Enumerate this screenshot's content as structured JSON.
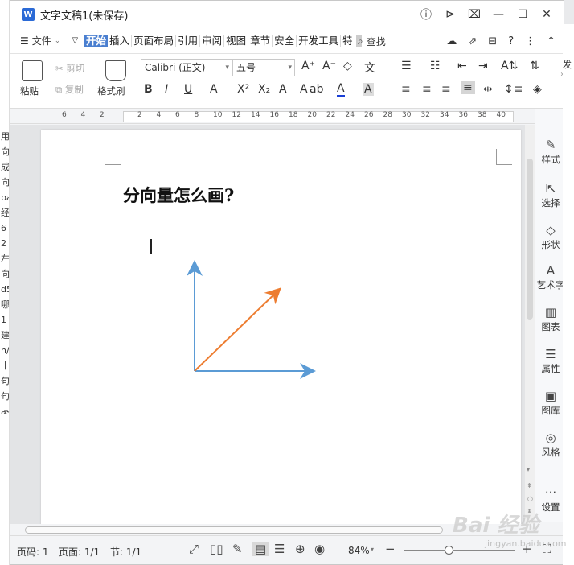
{
  "bg_left": [
    "用",
    "向",
    "成",
    "向",
    "ba",
    "经",
    "6",
    "2",
    "左",
    "向",
    "d5",
    "哪",
    "1",
    "建",
    "n/",
    "十",
    "句",
    "句",
    "as"
  ],
  "bg_right": [
    "",
    "发",
    "",
    "",
    "",
    "",
    "",
    "",
    "",
    "",
    "",
    "",
    "",
    "",
    "",
    "",
    "",
    "",
    "",
    "",
    "",
    "",
    "",
    "",
    "",
    "",
    "",
    "",
    ""
  ],
  "window": {
    "title": "文字文稿1(未保存)",
    "logo": "W"
  },
  "title_controls": [
    "ⓘ",
    "⊳",
    "⌧",
    "—",
    "☐",
    "✕"
  ],
  "menubar": {
    "file": "文件",
    "tabs": [
      {
        "label": "开始",
        "active": true
      },
      {
        "label": "插入"
      },
      {
        "label": "页面布局"
      },
      {
        "label": "引用"
      },
      {
        "label": "审阅"
      },
      {
        "label": "视图"
      },
      {
        "label": "章节"
      },
      {
        "label": "安全"
      },
      {
        "label": "开发工具"
      },
      {
        "label": "特"
      }
    ],
    "search": "查找"
  },
  "ribbon": {
    "paste": "粘贴",
    "cut": "剪切",
    "copy": "复制",
    "format_painter": "格式刷",
    "font": "Calibri (正文)",
    "size": "五号"
  },
  "document": {
    "heading": "分向量怎么画?",
    "vector_color": "#5b9bd5",
    "resultant_color": "#ed7d31"
  },
  "ruler_ticks": [
    "6",
    "4",
    "2",
    "",
    "2",
    "4",
    "6",
    "8",
    "10",
    "12",
    "14",
    "16",
    "18",
    "20",
    "22",
    "24",
    "26",
    "28",
    "30",
    "32",
    "34",
    "36",
    "38",
    "40"
  ],
  "side_panel": [
    {
      "label": "样式",
      "icon": "✎"
    },
    {
      "label": "选择",
      "icon": "⇱"
    },
    {
      "label": "形状",
      "icon": "◇"
    },
    {
      "label": "艺术字",
      "icon": "A"
    },
    {
      "label": "图表",
      "icon": "▥"
    },
    {
      "label": "属性",
      "icon": "☰"
    },
    {
      "label": "图库",
      "icon": "▣"
    },
    {
      "label": "风格",
      "icon": "◎"
    },
    {
      "label": "设置",
      "icon": "···"
    }
  ],
  "status": {
    "page_no": "页码: 1",
    "pages": "页面: 1/1",
    "section": "节: 1/1",
    "zoom": "84%"
  },
  "watermark": {
    "main": "Bai 经验",
    "sub": "jingyan.baidu.com"
  }
}
